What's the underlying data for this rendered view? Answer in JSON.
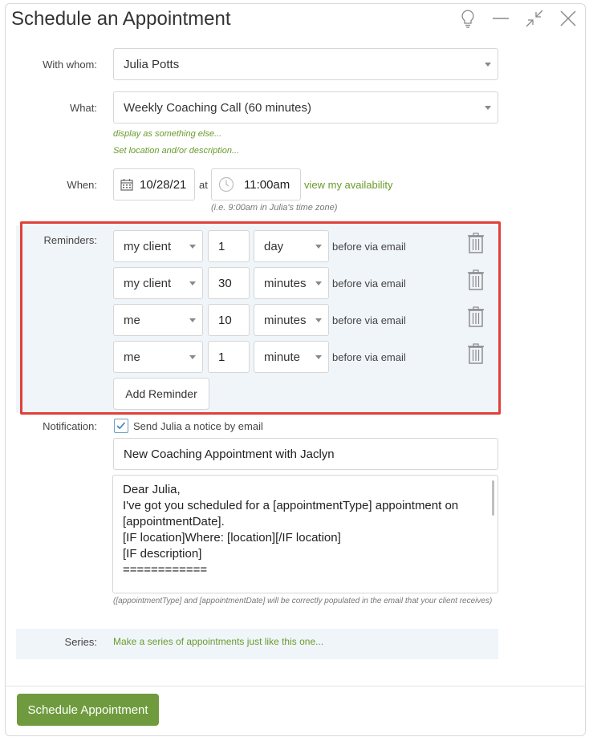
{
  "dialog": {
    "title": "Schedule an Appointment"
  },
  "with_whom": {
    "label": "With whom:",
    "value": "Julia Potts"
  },
  "what": {
    "label": "What:",
    "value": "Weekly Coaching Call (60 minutes)",
    "display_link": "display as something else...",
    "location_link": "Set location and/or description..."
  },
  "when": {
    "label": "When:",
    "date": "10/28/21",
    "at": "at",
    "time": "11:00am",
    "availability_link": "view my availability",
    "timezone_note": "(i.e. 9:00am in Julia's time zone)"
  },
  "reminders": {
    "label": "Reminders:",
    "rows": [
      {
        "who": "my client",
        "amount": "1",
        "unit": "day",
        "suffix": "before via email"
      },
      {
        "who": "my client",
        "amount": "30",
        "unit": "minutes",
        "suffix": "before via email"
      },
      {
        "who": "me",
        "amount": "10",
        "unit": "minutes",
        "suffix": "before via email"
      },
      {
        "who": "me",
        "amount": "1",
        "unit": "minute",
        "suffix": "before via email"
      }
    ],
    "add_button": "Add Reminder"
  },
  "notification": {
    "label": "Notification:",
    "checkbox_label": "Send Julia a notice by email",
    "checked": true,
    "subject": "New Coaching Appointment with Jaclyn",
    "body_lines": [
      "Dear Julia,",
      "",
      "I've got you scheduled for a [appointmentType] appointment on",
      "[appointmentDate].",
      "[IF location]Where: [location][/IF location]",
      "[IF description]",
      "============"
    ],
    "note": "([appointmentType] and [appointmentDate] will be correctly populated in the email that your client receives)"
  },
  "series": {
    "label": "Series:",
    "link": "Make a series of appointments just like this one..."
  },
  "footer": {
    "primary_button": "Schedule Appointment"
  },
  "colors": {
    "accent_green": "#6f9b3e",
    "link_green": "#6a9b2c",
    "highlight_red": "#e0403a",
    "panel_blue": "#f0f5fa"
  },
  "icons": [
    "lightbulb-icon",
    "minimize-icon",
    "collapse-icon",
    "close-icon",
    "calendar-icon",
    "clock-icon",
    "trash-icon",
    "checkmark-icon",
    "caret-down-icon"
  ]
}
